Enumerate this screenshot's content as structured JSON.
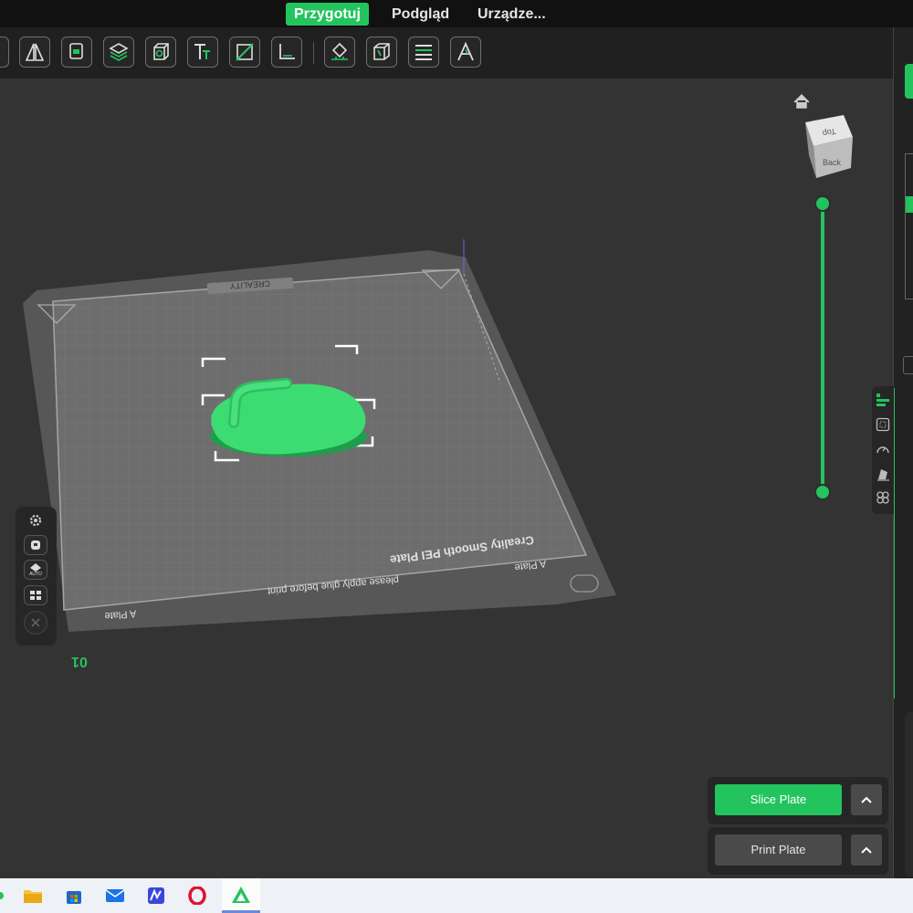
{
  "tabs": [
    {
      "label": "Przygotuj",
      "active": true
    },
    {
      "label": "Podgląd",
      "active": false
    },
    {
      "label": "Urządze..."
    }
  ],
  "toolbar": {
    "icons": [
      "mirror-icon",
      "arrange-icon",
      "split-layers-icon",
      "box-icon",
      "text-icon",
      "cut-icon",
      "measure-icon",
      "support-paint-icon",
      "cube-paint-icon",
      "layers-icon",
      "assembly-text-icon"
    ]
  },
  "viewcube": {
    "top_label": "Top",
    "back_label": "Back"
  },
  "plate": {
    "brand": "CREALITY",
    "name": "Creality Smooth PEI Plate",
    "glue_note": "please apply glue before print",
    "side_label_a": "A Plate",
    "side_label_b": "A Plate",
    "plate_number": "01"
  },
  "left_tools": {
    "auto_label": "AUTO"
  },
  "actions": {
    "slice_label": "Slice Plate",
    "print_label": "Print Plate"
  },
  "colors": {
    "accent": "#23c45e",
    "background": "#333333"
  }
}
